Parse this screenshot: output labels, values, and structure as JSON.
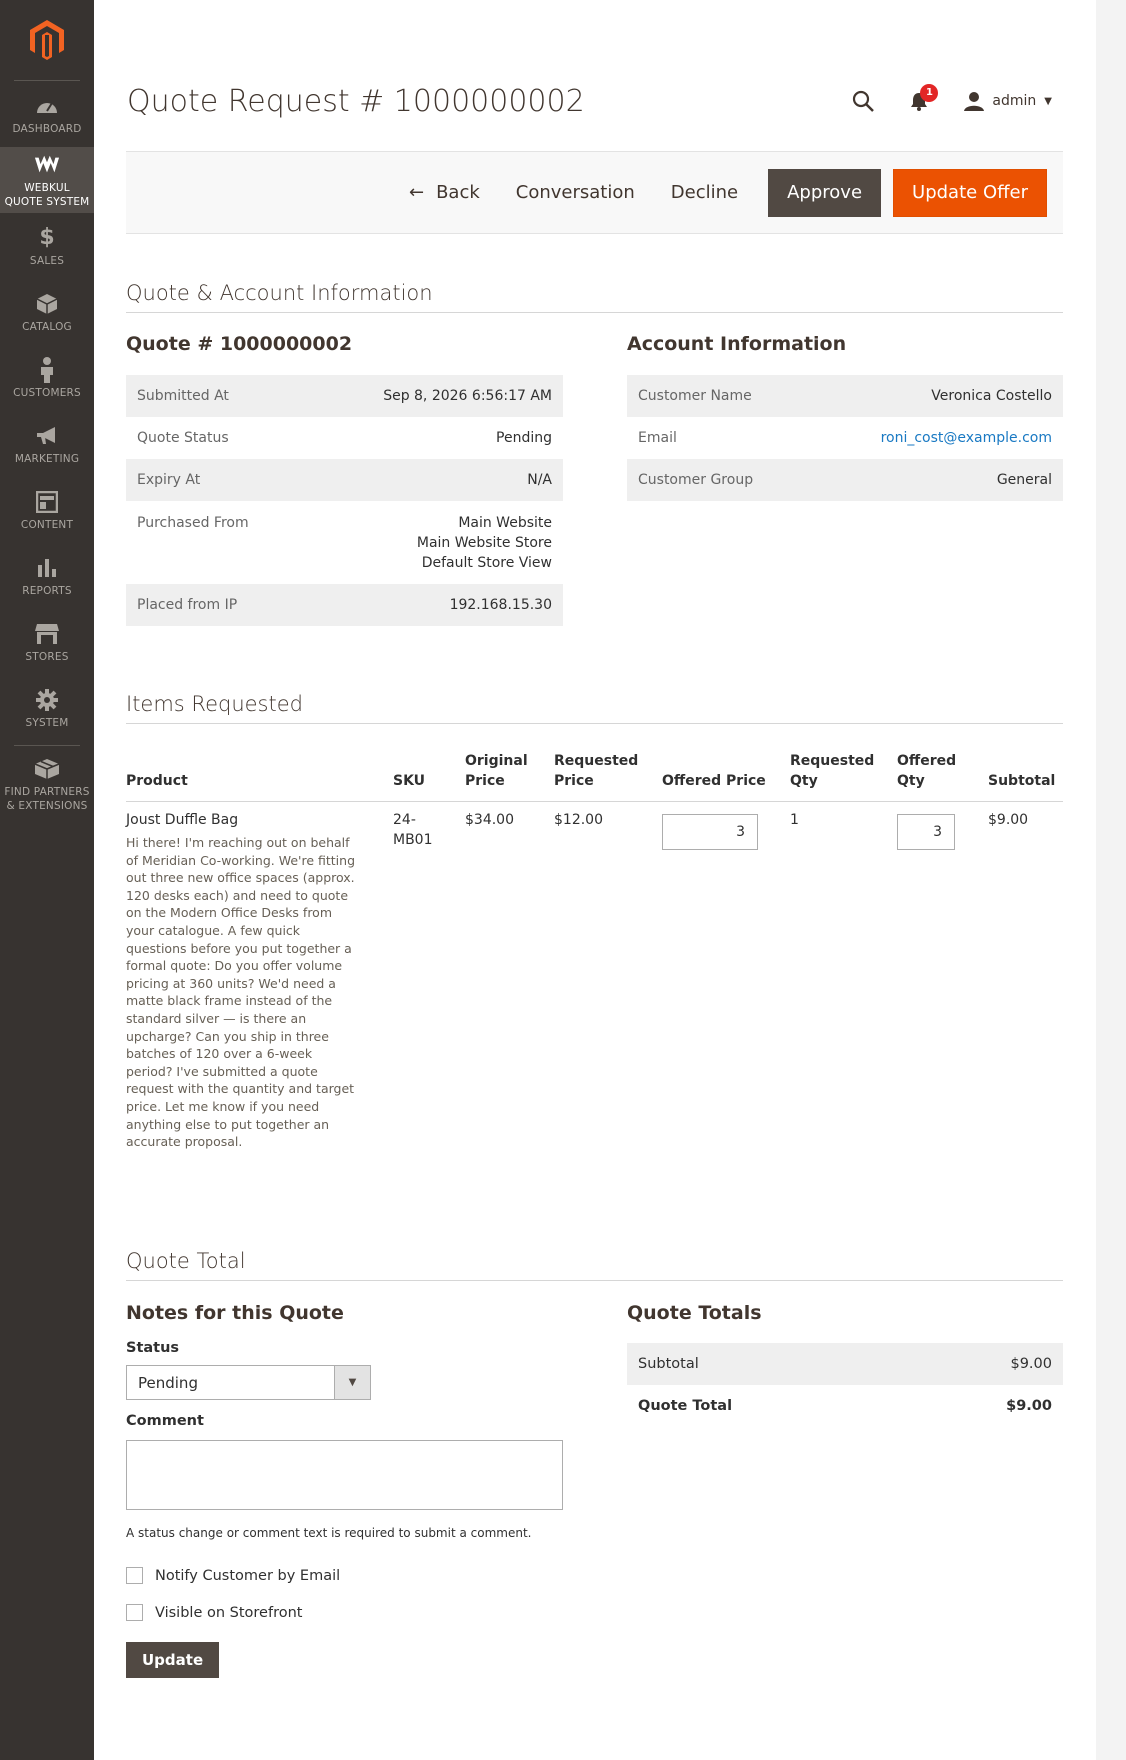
{
  "sidebar": {
    "logo": "magento-logo",
    "items": [
      {
        "label": "DASHBOARD",
        "icon": "dashboard-icon"
      },
      {
        "label": "WEBKUL QUOTE SYSTEM",
        "label_line1": "WEBKUL",
        "label_line2": "QUOTE SYSTEM",
        "icon": "webkul-icon",
        "active": true
      },
      {
        "label": "SALES",
        "icon": "dollar-icon"
      },
      {
        "label": "CATALOG",
        "icon": "cube-icon"
      },
      {
        "label": "CUSTOMERS",
        "icon": "person-icon"
      },
      {
        "label": "MARKETING",
        "icon": "megaphone-icon"
      },
      {
        "label": "CONTENT",
        "icon": "layout-icon"
      },
      {
        "label": "REPORTS",
        "icon": "bar-chart-icon"
      },
      {
        "label": "STORES",
        "icon": "storefront-icon"
      },
      {
        "label": "SYSTEM",
        "icon": "gear-icon"
      },
      {
        "label": "FIND PARTNERS & EXTENSIONS",
        "label_line1": "FIND PARTNERS",
        "label_line2": "& EXTENSIONS",
        "icon": "boxes-icon"
      }
    ]
  },
  "header": {
    "title": "Quote Request # 1000000002",
    "notification_count": "1",
    "user": "admin"
  },
  "actions": {
    "back": "Back",
    "conversation": "Conversation",
    "decline": "Decline",
    "approve": "Approve",
    "update_offer": "Update Offer"
  },
  "quote_account": {
    "section_title": "Quote & Account Information",
    "quote": {
      "title": "Quote # 1000000002",
      "rows": [
        {
          "label": "Submitted At",
          "value": "Sep 8, 2026 6:56:17 AM"
        },
        {
          "label": "Quote Status",
          "value": "Pending"
        },
        {
          "label": "Expiry At",
          "value": "N/A"
        },
        {
          "label": "Purchased From",
          "value_line1": "Main Website",
          "value_line2": "Main Website Store",
          "value_line3": "Default Store View"
        },
        {
          "label": "Placed from IP",
          "value": "192.168.15.30"
        }
      ]
    },
    "account": {
      "title": "Account Information",
      "rows": [
        {
          "label": "Customer Name",
          "value": "Veronica Costello"
        },
        {
          "label": "Email",
          "value": "roni_cost@example.com"
        },
        {
          "label": "Customer Group",
          "value": "General"
        }
      ]
    }
  },
  "items": {
    "section_title": "Items Requested",
    "headers": {
      "product": "Product",
      "sku": "SKU",
      "original_price_1": "Original",
      "original_price_2": "Price",
      "requested_price_1": "Requested",
      "requested_price_2": "Price",
      "offered_price": "Offered Price",
      "requested_qty_1": "Requested",
      "requested_qty_2": "Qty",
      "offered_qty_1": "Offered",
      "offered_qty_2": "Qty",
      "subtotal": "Subtotal"
    },
    "rows": [
      {
        "product": "Joust Duffle Bag",
        "note": "Hi there! I'm reaching out on behalf of Meridian Co-working. We're fitting out three new office spaces (approx. 120 desks each) and need to quote on the Modern Office Desks from your catalogue. A few quick questions before you put together a formal quote: Do you offer volume pricing at 360 units? We'd need a matte black frame instead of the standard silver — is there an upcharge? Can you ship in three batches of 120 over a 6-week period? I've submitted a quote request with the quantity and target price. Let me know if you need anything else to put together an accurate proposal.",
        "sku_1": "24-",
        "sku_2": "MB01",
        "original_price": "$34.00",
        "requested_price": "$12.00",
        "offered_price": "3",
        "requested_qty": "1",
        "offered_qty": "3",
        "subtotal": "$9.00"
      }
    ]
  },
  "quote_total": {
    "section_title": "Quote Total",
    "notes": {
      "title": "Notes for this Quote",
      "status_label": "Status",
      "status_value": "Pending",
      "comment_label": "Comment",
      "comment_value": "",
      "help_text": "A status change or comment text is required to submit a comment.",
      "notify_label": "Notify Customer by Email",
      "visible_label": "Visible on Storefront",
      "update_button": "Update"
    },
    "totals": {
      "title": "Quote Totals",
      "subtotal_label": "Subtotal",
      "subtotal_value": "$9.00",
      "grand_label": "Quote Total",
      "grand_value": "$9.00"
    }
  },
  "colors": {
    "sidebar_bg": "#373330",
    "accent_orange": "#eb5202",
    "button_dark": "#514943",
    "link_blue": "#1979c3"
  }
}
